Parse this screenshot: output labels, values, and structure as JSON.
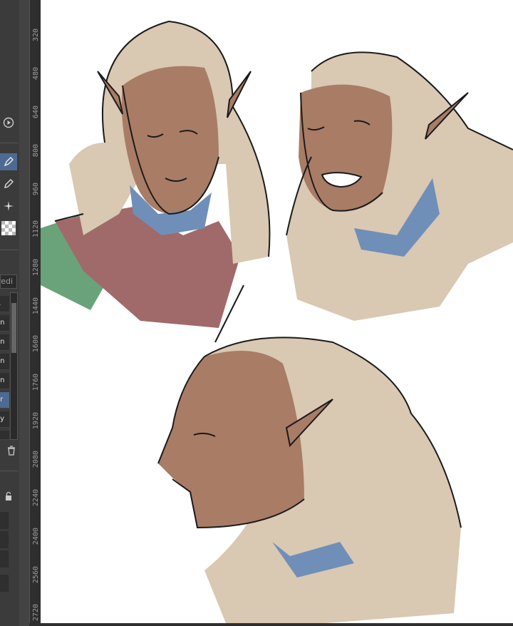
{
  "ruler": {
    "labels": [
      "320",
      "480",
      "640",
      "800",
      "960",
      "1120",
      "1280",
      "1440",
      "1600",
      "1760",
      "1920",
      "2080",
      "2240",
      "2400",
      "2560",
      "2720"
    ]
  },
  "layers": {
    "blend_placeholder": "redi",
    "rows": [
      "R",
      "en",
      "en",
      "en",
      "en",
      "er",
      "ay",
      "e"
    ]
  },
  "colors": {
    "skin": "#a97c66",
    "hair": "#d9c8b2",
    "robe": "#a06a6a",
    "collar": "#6f8fb8",
    "green": "#6aa37a",
    "line": "#1a1a1a",
    "accent": "#4d6a93"
  },
  "icons": [
    "play-circle-icon",
    "pen-icon",
    "pencil-icon",
    "sparkle-brush-icon",
    "transparency-icon",
    "trash-icon",
    "lock-icon"
  ]
}
